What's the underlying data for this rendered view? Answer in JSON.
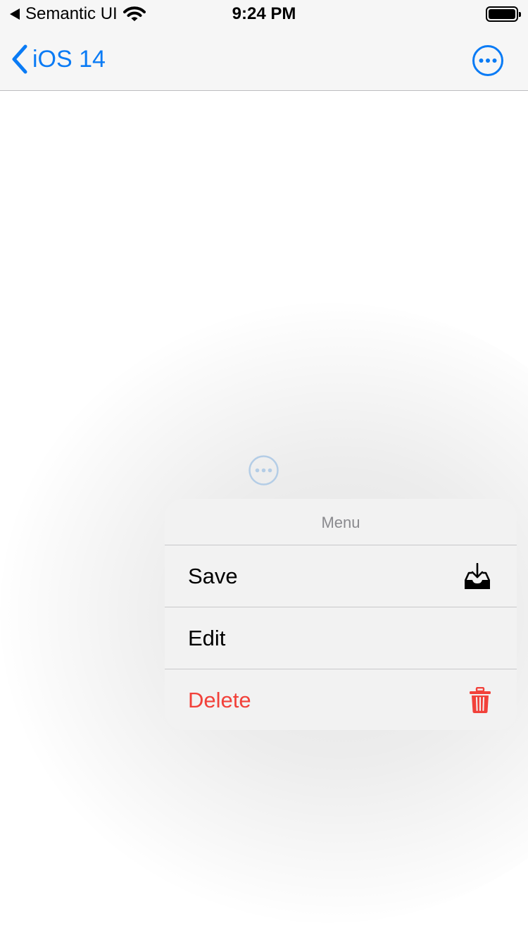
{
  "status_bar": {
    "carrier": "Semantic UI",
    "time": "9:24 PM",
    "icons": [
      "back-arrow-icon",
      "wifi-icon",
      "battery-icon"
    ]
  },
  "nav_bar": {
    "back_label": "iOS 14",
    "back_icon": "chevron-left-icon",
    "more_icon": "ellipsis-circle-icon",
    "tint_color": "#0a7bf5"
  },
  "context_menu": {
    "title": "Menu",
    "items": [
      {
        "label": "Save",
        "icon": "tray-download-icon",
        "destructive": false
      },
      {
        "label": "Edit",
        "icon": "",
        "destructive": false
      },
      {
        "label": "Delete",
        "icon": "trash-icon",
        "destructive": true
      }
    ],
    "destructive_color": "#f2413a"
  }
}
